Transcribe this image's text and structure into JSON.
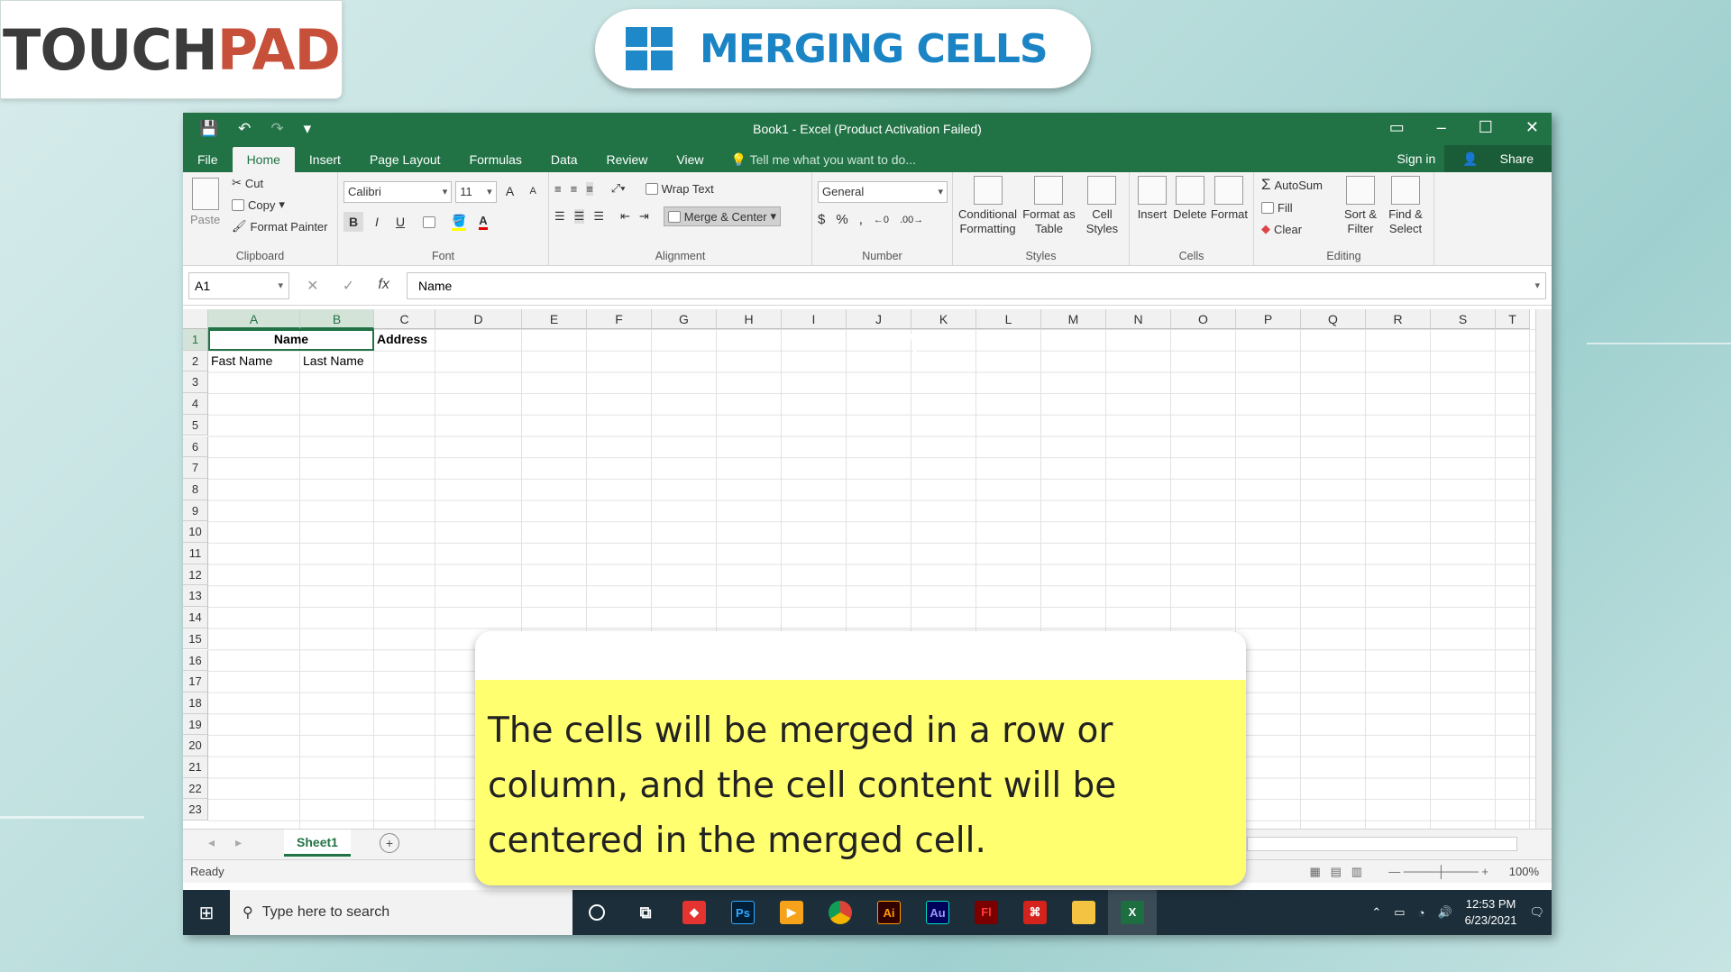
{
  "logo": {
    "part1": "TOUCH",
    "part2": "PAD"
  },
  "banner": {
    "title": "MERGING CELLS"
  },
  "excel": {
    "window_title": "Book1 - Excel (Product Activation Failed)",
    "tabs": [
      "File",
      "Home",
      "Insert",
      "Page Layout",
      "Formulas",
      "Data",
      "Review",
      "View"
    ],
    "active_tab": "Home",
    "tell_me": "Tell me what you want to do...",
    "sign_in": "Sign in",
    "share": "Share",
    "clipboard": {
      "paste": "Paste",
      "cut": "Cut",
      "copy": "Copy",
      "format_painter": "Format Painter",
      "label": "Clipboard"
    },
    "font": {
      "name": "Calibri",
      "size": "11",
      "grow": "A",
      "shrink": "A",
      "bold": "B",
      "italic": "I",
      "underline": "U",
      "label": "Font"
    },
    "alignment": {
      "wrap_text": "Wrap Text",
      "merge_center": "Merge & Center",
      "label": "Alignment"
    },
    "number": {
      "format": "General",
      "currency": "$",
      "percent": "%",
      "comma": ",",
      "label": "Number"
    },
    "styles": {
      "conditional": "Conditional Formatting",
      "format_table": "Format as Table",
      "cell_styles": "Cell Styles",
      "label": "Styles"
    },
    "cells": {
      "insert": "Insert",
      "delete": "Delete",
      "format": "Format",
      "label": "Cells"
    },
    "editing": {
      "autosum": "AutoSum",
      "fill": "Fill",
      "clear": "Clear",
      "sort": "Sort & Filter",
      "find": "Find & Select",
      "label": "Editing"
    },
    "name_box": "A1",
    "formula": "Name",
    "columns": [
      "A",
      "B",
      "C",
      "D",
      "E",
      "F",
      "G",
      "H",
      "I",
      "J",
      "K",
      "L",
      "M",
      "N",
      "O",
      "P",
      "Q",
      "R",
      "S",
      "T"
    ],
    "rows": [
      "1",
      "2",
      "3",
      "4",
      "5",
      "6",
      "7",
      "8",
      "9",
      "10",
      "11",
      "12",
      "13",
      "14",
      "15",
      "16",
      "17",
      "18",
      "19",
      "20",
      "21",
      "22",
      "23"
    ],
    "cell_values": {
      "A1": "Name",
      "C1": "Address",
      "A2": "Fast Name",
      "B2": "Last Name"
    },
    "sheet_tab": "Sheet1",
    "status": "Ready",
    "zoom": "100%"
  },
  "taskbar": {
    "search": "Type here to search",
    "time": "12:53 PM",
    "date": "6/23/2021"
  },
  "callout": {
    "text": "The cells will be merged in a row or column, and the cell content will be centered in the merged cell."
  }
}
